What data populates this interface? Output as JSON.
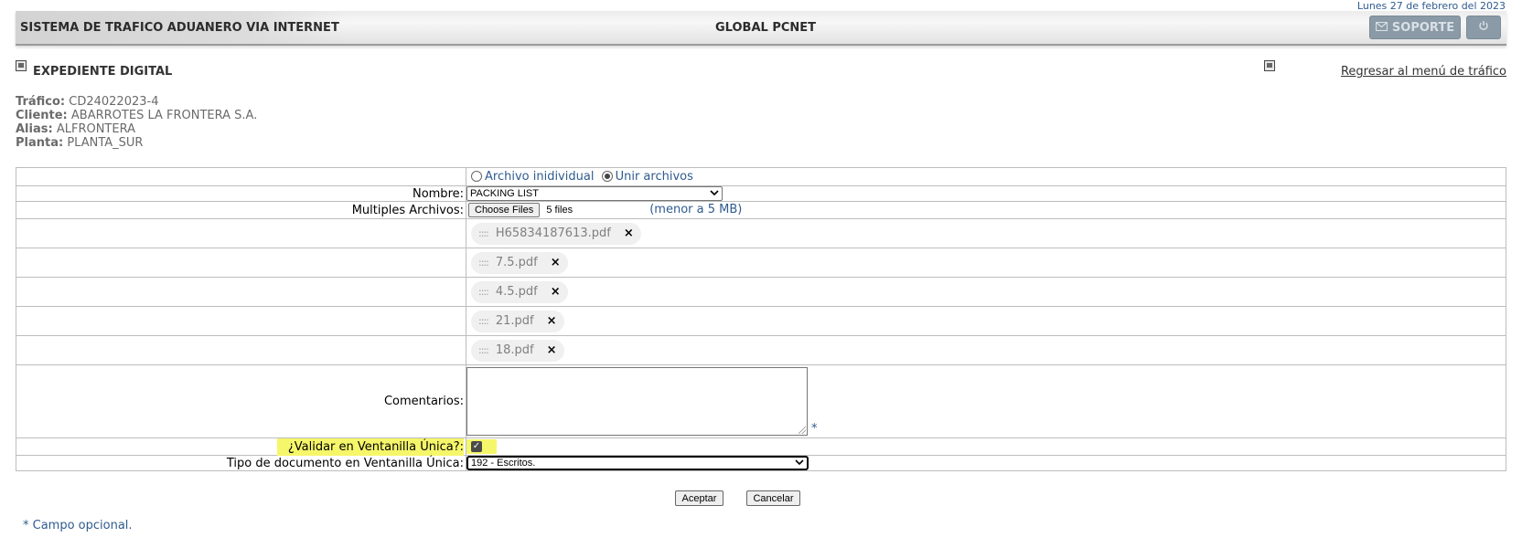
{
  "header": {
    "date": "Lunes 27 de febrero del 2023",
    "system_title": "SISTEMA DE TRAFICO ADUANERO VIA INTERNET",
    "center_title": "GLOBAL PCNET",
    "support_label": "SOPORTE"
  },
  "section": {
    "title": "EXPEDIENTE DIGITAL",
    "back_link": "Regresar al menú de tráfico"
  },
  "info": {
    "trafico_label": "Tráfico:",
    "trafico": "CD24022023-4",
    "cliente_label": "Cliente:",
    "cliente": "ABARROTES LA FRONTERA S.A.",
    "alias_label": "Alias:",
    "alias": "ALFRONTERA",
    "planta_label": "Planta:",
    "planta": "PLANTA_SUR"
  },
  "form": {
    "radio_individual": "Archivo inidividual",
    "radio_unir": "Unir archivos",
    "nombre_label": "Nombre:",
    "nombre_value": "PACKING LIST",
    "archivos_label": "Multiples Archivos:",
    "choose_files": "Choose Files",
    "files_count": "5 files",
    "size_note": "(menor a 5 MB)",
    "files": [
      "H65834187613.pdf",
      "7.5.pdf",
      "4.5.pdf",
      "21.pdf",
      "18.pdf"
    ],
    "comentarios_label": "Comentarios:",
    "validar_label": "¿Validar en Ventanilla Única?:",
    "tipo_label": "Tipo de documento en Ventanilla Única:",
    "tipo_value": "192 - Escritos.",
    "accept": "Aceptar",
    "cancel": "Cancelar",
    "optional_note": "* Campo opcional."
  }
}
